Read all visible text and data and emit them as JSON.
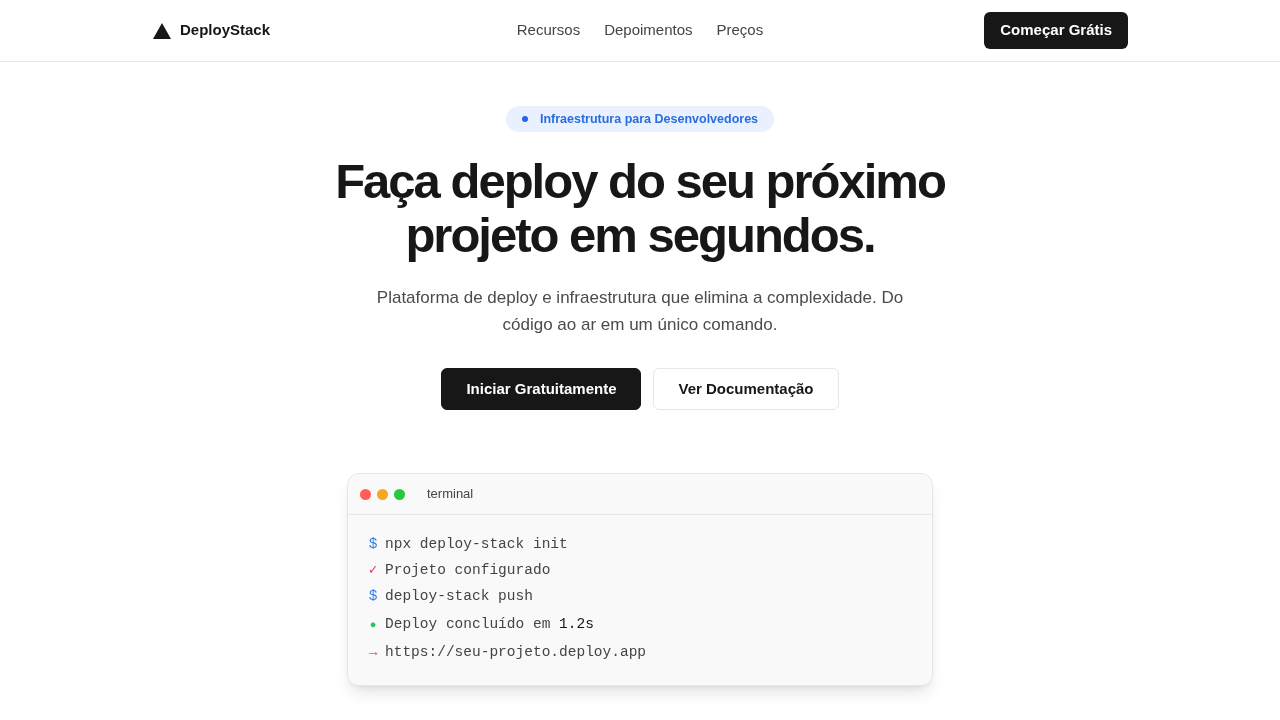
{
  "brand": "DeployStack",
  "nav": [
    "Recursos",
    "Depoimentos",
    "Preços"
  ],
  "cta": "Começar Grátis",
  "badge": "Infraestrutura para Desenvolvedores",
  "headline": "Faça deploy do seu próximo projeto em segundos.",
  "subtitle": "Plataforma de deploy e infraestrutura que elimina a complexidade. Do código ao ar em um único comando.",
  "buttons": [
    {
      "label": "Iniciar Gratuitamente",
      "kind": "primary"
    },
    {
      "label": "Ver Documentação",
      "kind": "secondary"
    }
  ],
  "terminal": {
    "title": "terminal",
    "lines": [
      {
        "kind": "prompt",
        "symbol": "$",
        "text": "npx deploy-stack init"
      },
      {
        "kind": "success",
        "symbol": "✓",
        "text": "Projeto configurado"
      },
      {
        "kind": "prompt",
        "symbol": "$",
        "text": "deploy-stack push"
      },
      {
        "kind": "status",
        "symbol": "●",
        "text": "Deploy concluído em",
        "highlight": "1.2s"
      },
      {
        "kind": "link",
        "symbol": "→",
        "text": "https://seu-projeto.deploy.app"
      }
    ]
  }
}
